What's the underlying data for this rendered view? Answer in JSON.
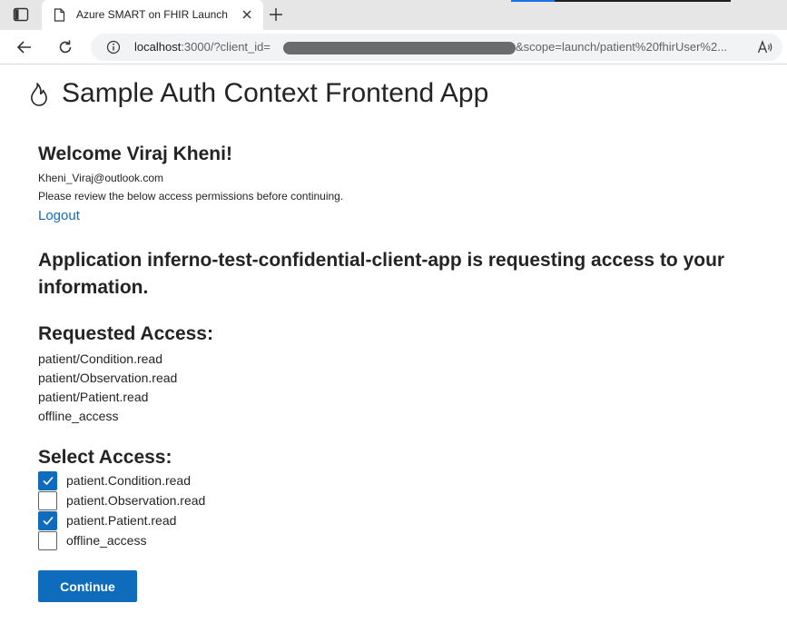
{
  "browser": {
    "tab_title": "Azure SMART on FHIR Launch",
    "url_host": "localhost",
    "url_after_host": ":3000/?client_id=",
    "url_tail": "&scope=launch/patient%20fhirUser%2...",
    "accent_color": "#1a73e8"
  },
  "icons": {
    "tab_actions": "tab-actions-icon",
    "favicon": "document-icon",
    "tab_close": "close-icon",
    "new_tab": "plus-icon",
    "back": "arrow-left-icon",
    "reload": "reload-icon",
    "site_info": "info-icon",
    "read_aloud": "read-aloud-icon",
    "app_logo": "flame-icon",
    "check": "checkmark-icon"
  },
  "app": {
    "title": "Sample Auth Context Frontend App"
  },
  "user": {
    "welcome": "Welcome Viraj Kheni!",
    "email": "Kheni_Viraj@outlook.com",
    "review_note": "Please review the below access permissions before continuing.",
    "logout_label": "Logout"
  },
  "request": {
    "message": "Application inferno-test-confidential-client-app is requesting access to your information."
  },
  "requested_access": {
    "heading": "Requested Access:",
    "scopes": [
      "patient/Condition.read",
      "patient/Observation.read",
      "patient/Patient.read",
      "offline_access"
    ]
  },
  "select_access": {
    "heading": "Select Access:",
    "options": [
      {
        "label": "patient.Condition.read",
        "checked": true
      },
      {
        "label": "patient.Observation.read",
        "checked": false
      },
      {
        "label": "patient.Patient.read",
        "checked": true
      },
      {
        "label": "offline_access",
        "checked": false
      }
    ]
  },
  "actions": {
    "continue_label": "Continue",
    "primary_color": "#0f6cbd"
  }
}
